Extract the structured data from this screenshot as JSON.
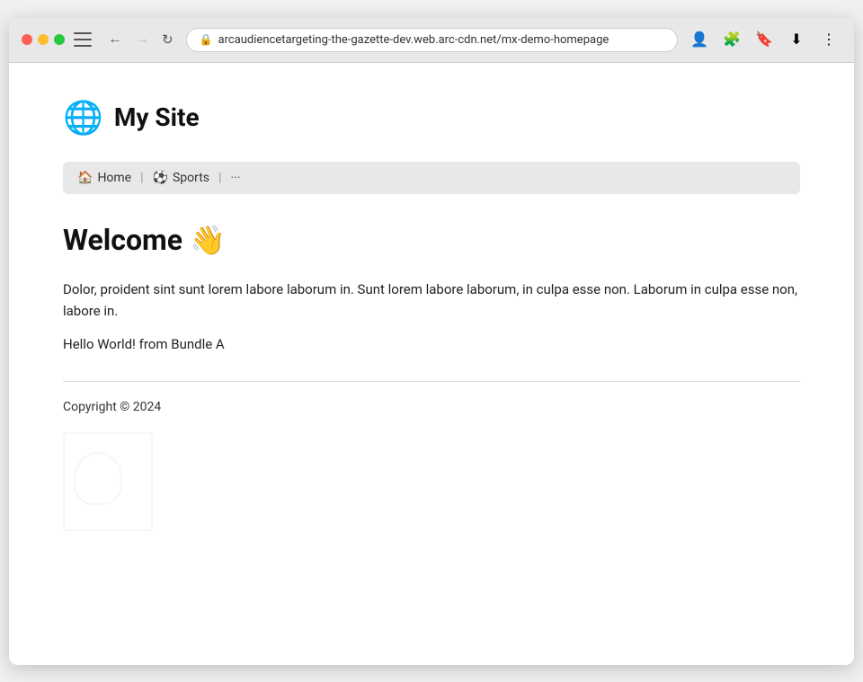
{
  "browser": {
    "url": "arcaudiencetargeting-the-gazette-dev.web.arc-cdn.net/mx-demo-homepage",
    "url_prefix": "arcaudiencetargeting-the-gazette-dev.web.arc-cdn.net",
    "url_path": "/mx-demo-homepage",
    "back_disabled": false,
    "forward_disabled": true
  },
  "site": {
    "logo": "🌐",
    "title": "My Site"
  },
  "nav": {
    "items": [
      {
        "icon": "🏠",
        "label": "Home"
      },
      {
        "icon": "⚽",
        "label": "Sports"
      }
    ],
    "more": "···"
  },
  "main": {
    "heading": "Welcome",
    "heading_emoji": "👋",
    "body_text": "Dolor, proident sint sunt lorem labore laborum in. Sunt lorem labore laborum, in culpa esse non. Laborum in culpa esse non, labore in.",
    "hello_world": "Hello World! from Bundle A"
  },
  "footer": {
    "copyright": "Copyright © 2024"
  }
}
